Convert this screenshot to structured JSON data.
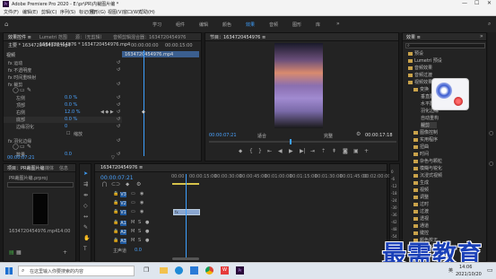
{
  "title_bar": {
    "title": "Adobe Premiere Pro 2020 - E:\\pr\\PR\\内裁图片编 *"
  },
  "menu": [
    "文件(F)",
    "编辑(E)",
    "剪辑(C)",
    "序列(S)",
    "标记(M)",
    "图形(G)",
    "视图(V)",
    "窗口(W)",
    "帮助(H)"
  ],
  "workspaces": [
    "学习",
    "组件",
    "编辑",
    "颜色",
    "效果",
    "音频",
    "图形",
    "库"
  ],
  "workspace_active": "效果",
  "effect_controls": {
    "tabs": [
      "效果控件 ≡",
      "Lumetri 范围",
      "源：（无剪辑）",
      "音频剪辑混合器：1634720454976"
    ],
    "master": "主要 * 1634720454976.mp4",
    "seq": "1634720454976 * 1634720454976.mp4",
    "timecodes": [
      "00:00:00:00",
      "00:00:15:00"
    ],
    "clip_label": "1634720454976.mp4",
    "section_video": "视频",
    "rows": [
      {
        "label": "fx 运动",
        "value": ""
      },
      {
        "label": "fx 不透明度",
        "value": ""
      },
      {
        "label": "fx 时间重映射",
        "value": ""
      },
      {
        "label": "fx 裁剪",
        "value": ""
      },
      {
        "label": "左侧",
        "value": "0.0 %"
      },
      {
        "label": "顶部",
        "value": "0.0 %"
      },
      {
        "label": "右侧",
        "value": "12.0 %"
      },
      {
        "label": "底部",
        "value": "0.0 %"
      },
      {
        "label": "边缘羽化",
        "value": "0"
      },
      {
        "label": "",
        "value": "缩放"
      },
      {
        "label": "fx 羽化边缘",
        "value": ""
      },
      {
        "label": "数量",
        "value": "0.0"
      }
    ],
    "bottom_tc": "00:00:07:21"
  },
  "program": {
    "title": "节目：1634720454976 ≡",
    "timecode": "00:00:07:21",
    "fit": "适合",
    "quality": "完整",
    "duration": "00:00:17:18"
  },
  "effects": {
    "title": "效果 ≡",
    "items": [
      "预设",
      "Lumetri 预设",
      "音频效果",
      "音频过渡",
      "视频效果",
      "变换",
      "垂直翻转",
      "水平翻转",
      "羽化边缘",
      "自动重构",
      "裁剪",
      "图像控制",
      "实用程序",
      "扭曲",
      "时间",
      "杂色与颗粒",
      "模糊与锐化",
      "沉浸式视频",
      "生成",
      "视频",
      "调整",
      "过时",
      "过渡",
      "透视",
      "通道",
      "键控",
      "颜色校正",
      "风格化"
    ]
  },
  "project": {
    "tabs": [
      "项目：PR裁图片编",
      "媒体",
      "信息"
    ],
    "file": "PR裁图片编.prproj",
    "media_name": "1634720454976.mp4",
    "media_dur": "14:00"
  },
  "timeline": {
    "title": "1634720454976 ≡",
    "timecode": "00:00:07:21",
    "ruler": [
      "00:00",
      "00:00:15:00",
      "00:00:30:00",
      "00:00:45:00",
      "00:01:00:00",
      "00:01:15:00",
      "00:01:30:00",
      "00:01:45:00",
      "00:02:00:00"
    ],
    "tracks": [
      "V3",
      "V2",
      "V1",
      "A1",
      "A2",
      "A3",
      "主声道"
    ],
    "master_value": "0.0"
  },
  "meter": [
    "0",
    "-6",
    "-12",
    "-18",
    "-24",
    "-30",
    "-36",
    "-42",
    "-48",
    "-54",
    "dB"
  ],
  "watermark": "最需教育",
  "taskbar": {
    "search": "在这里输入你要搜索的内容",
    "time": "14:06",
    "date": "2021/10/20",
    "lang": "英"
  },
  "colors": {
    "accent": "#3ea0ff",
    "clip": "#8aa6d0"
  }
}
